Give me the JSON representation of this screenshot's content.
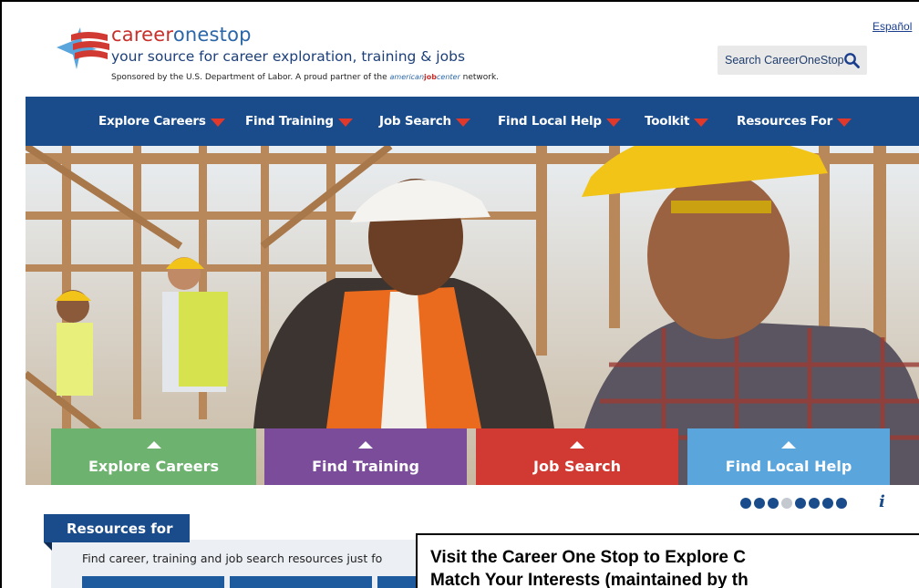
{
  "header": {
    "brand_part1": "career",
    "brand_part2": "onestop",
    "tagline": "your source for career exploration, training & jobs",
    "sponsor_text": "Sponsored by the U.S. Department of Labor. A proud partner of the",
    "ajc_part1": "american",
    "ajc_part2": "job",
    "ajc_part3": "center",
    "sponsor_suffix": "network.",
    "espanol_link": "Español",
    "search_label": "Search CareerOneStop"
  },
  "nav": {
    "items": [
      {
        "label": "Explore Careers"
      },
      {
        "label": "Find Training"
      },
      {
        "label": "Job Search"
      },
      {
        "label": "Find Local Help"
      },
      {
        "label": "Toolkit"
      },
      {
        "label": "Resources For"
      }
    ]
  },
  "tiles": [
    {
      "label": "Explore Careers",
      "color": "#6db36f"
    },
    {
      "label": "Find Training",
      "color": "#7b4c9a"
    },
    {
      "label": "Job Search",
      "color": "#d13a33"
    },
    {
      "label": "Find Local Help",
      "color": "#5aa5dc"
    }
  ],
  "carousel": {
    "total_slides": 8,
    "active_slide": 3,
    "info_glyph": "i"
  },
  "resources": {
    "tab_label": "Resources for",
    "intro": "Find career, training and job search resources just fo"
  },
  "caption": {
    "line1": "Visit the Career One Stop to Explore C",
    "line2": "Match Your Interests (maintained by th"
  },
  "colors": {
    "nav_bg": "#1a4c8c",
    "accent_red": "#e0392b",
    "brand_red": "#c8302c",
    "brand_blue": "#2b67a8"
  }
}
